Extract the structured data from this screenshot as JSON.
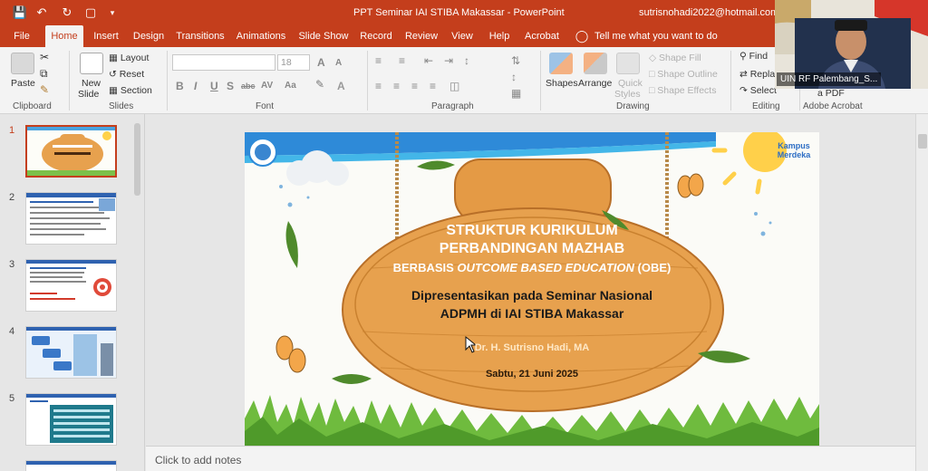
{
  "window": {
    "title": "PPT Seminar IAI STIBA Makassar  -  PowerPoint",
    "user": "sutrisnohadi2022@hotmail.com"
  },
  "tabs": [
    "File",
    "Home",
    "Insert",
    "Design",
    "Transitions",
    "Animations",
    "Slide Show",
    "Record",
    "Review",
    "View",
    "Help",
    "Acrobat"
  ],
  "tell_me": "Tell me what you want to do",
  "ribbon": {
    "clipboard": {
      "paste": "Paste",
      "label": "Clipboard"
    },
    "slides": {
      "new_slide_1": "New",
      "new_slide_2": "Slide",
      "layout": "Layout",
      "reset": "Reset",
      "section": "Section",
      "label": "Slides"
    },
    "font": {
      "size": "18",
      "label": "Font"
    },
    "paragraph": {
      "label": "Paragraph"
    },
    "drawing": {
      "shapes": "Shapes",
      "arrange": "Arrange",
      "quick_1": "Quick",
      "quick_2": "Styles",
      "fill": "Shape Fill",
      "outline": "Shape Outline",
      "effects": "Shape Effects",
      "label": "Drawing"
    },
    "editing": {
      "find": "Find",
      "replace": "Replac",
      "select": "Select",
      "label": "Editing"
    },
    "acrobat": {
      "pdf": "a PDF",
      "label": "Adobe Acrobat"
    }
  },
  "webcam": {
    "label": "UIN RF Palembang_S..."
  },
  "thumbnails": [
    "1",
    "2",
    "3",
    "4",
    "5"
  ],
  "slide": {
    "line1": "STRUKTUR KURIKULUM",
    "line2": "PERBANDINGAN MAZHAB",
    "line3_pre": "BERBASIS ",
    "line3_em": "OUTCOME BASED EDUCATION",
    "line3_post": " (OBE)",
    "present1": "Dipresentasikan pada Seminar Nasional",
    "present2": "ADPMH di IAI STIBA Makassar",
    "author": "Dr. H. Sutrisno Hadi, MA",
    "date": "Sabtu, 21 Juni 2025",
    "logo": "Kampus Merdeka"
  },
  "notes": "Click to add notes",
  "colors": {
    "accent": "#c43e1c",
    "wood": "#e7a14e",
    "wood_dark": "#c97b2e"
  }
}
